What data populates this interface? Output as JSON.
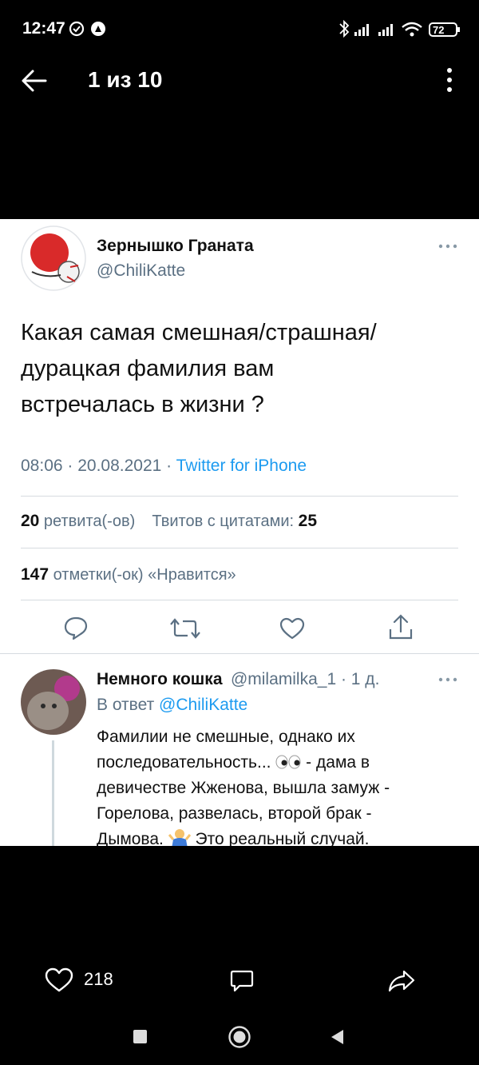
{
  "status_bar": {
    "time": "12:47",
    "battery": "72"
  },
  "header": {
    "counter": "1 из 10"
  },
  "tweet": {
    "author_name": "Зернышко Граната",
    "author_handle": "@ChiliKatte",
    "text_lines": [
      "Какая самая смешная/страшная/",
      "дурацкая фамилия вам",
      "встречалась в жизни ?"
    ],
    "time": "08:06 · 20.08.2021 · ",
    "source": "Twitter for iPhone",
    "retweets_count": "20",
    "retweets_label": " ретвита(-ов)",
    "quotes_label": "Твитов с цитатами: ",
    "quotes_count": "25",
    "likes_count": "147",
    "likes_label": " отметки(-ок) «Нравится»"
  },
  "reply": {
    "author_name": "Немного кошка",
    "meta": "@milamilka_1 · 1 д.",
    "in_reply_prefix": "В ответ ",
    "in_reply_handle": "@ChiliKatte",
    "line1": "Фамилии не смешные, однако их",
    "line2a": "последовательность...",
    "line2b": " - дама в",
    "line3": "девичестве Жженова, вышла замуж -",
    "line4": "Горелова, развелась, второй брак -",
    "line5a": "Дымова.",
    "line5b": " Это реальный случай."
  },
  "viewer_bar": {
    "likes": "218"
  },
  "colors": {
    "accent": "#1d9bf0",
    "secondary": "#5b7083"
  }
}
